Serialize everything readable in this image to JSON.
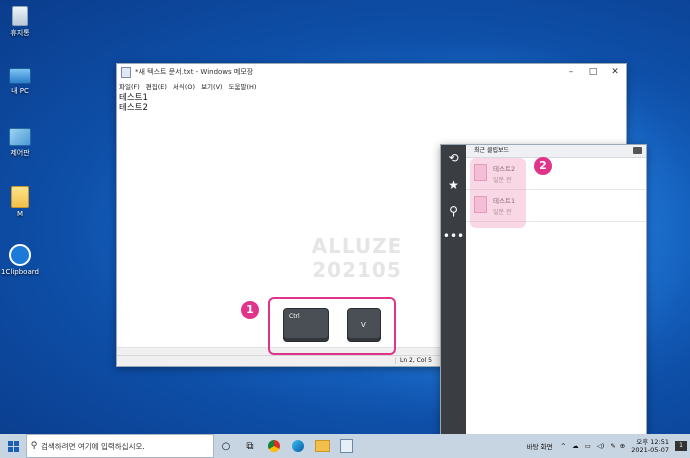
{
  "desktop": {
    "icons": [
      {
        "label": "휴지통",
        "icon": "recycle-bin-icon"
      },
      {
        "label": "내 PC",
        "icon": "computer-icon"
      },
      {
        "label": "제어판",
        "icon": "control-panel-icon"
      },
      {
        "label": "M",
        "icon": "folder-icon"
      },
      {
        "label": "1Clipboard",
        "icon": "clipboard-app-icon"
      }
    ]
  },
  "notepad": {
    "title": "*새 텍스트 문서.txt - Windows 메모장",
    "menu": [
      "파일(F)",
      "편집(E)",
      "서식(O)",
      "보기(V)",
      "도움말(H)"
    ],
    "lines": [
      "테스트1",
      "테스트2"
    ],
    "status": "Ln 2, Col 5",
    "watermark": [
      "ALLUZE",
      "202105"
    ]
  },
  "keys": {
    "ctrl": "Ctrl",
    "v": "V"
  },
  "badges": {
    "one": "1",
    "two": "2"
  },
  "clipboard": {
    "header": "최근 클립보드",
    "items": [
      {
        "name": "테스트2",
        "time": "일분 전"
      },
      {
        "name": "테스트1",
        "time": "일분 전"
      }
    ]
  },
  "taskbar": {
    "search_placeholder": "검색하려면 여기에 입력하십시오.",
    "desktop_label": "바탕 화면",
    "time": "오후 12:51",
    "date": "2021-05-07",
    "notification_count": "1"
  },
  "colors": {
    "accent": "#e0338a",
    "desktop": "#1a6fd0"
  }
}
